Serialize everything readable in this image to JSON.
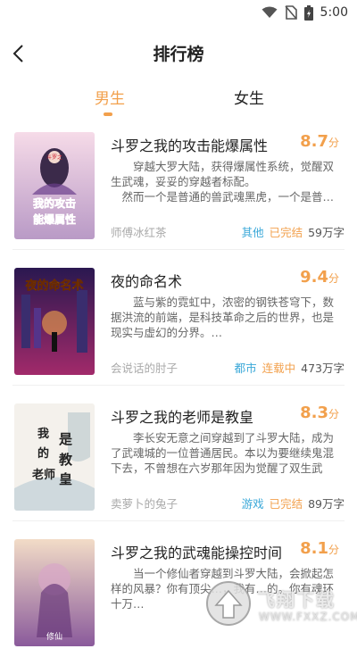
{
  "status_bar": {
    "time": "5:00"
  },
  "header": {
    "title": "排行榜"
  },
  "tabs": [
    {
      "label": "男生",
      "active": true
    },
    {
      "label": "女生",
      "active": false
    }
  ],
  "books": [
    {
      "title": "斗罗之我的攻击能爆属性",
      "score": "8.7",
      "score_unit": "分",
      "desc": "穿越大罗大陆，获得爆属性系统，觉醒双生武魂，妥妥的穿越者标配。\n然而一个是普通的兽武魂黑虎，一个是普…",
      "author": "师傅冰红茶",
      "genre": "其他",
      "status": "已完结",
      "words": "59万字",
      "cover_text": "我的攻击能爆属性",
      "cover_tag": "斗罗之"
    },
    {
      "title": "夜的命名术",
      "score": "9.4",
      "score_unit": "分",
      "desc": "蓝与紫的霓虹中，浓密的钢铁苍穹下，数据洪流的前端，是科技革命之后的世界，也是现实与虚幻的分界。…",
      "author": "会说话的肘子",
      "genre": "都市",
      "status": "连载中",
      "words": "473万字",
      "cover_text": "夜的命名术"
    },
    {
      "title": "斗罗之我的老师是教皇",
      "score": "8.3",
      "score_unit": "分",
      "desc": "李长安无意之间穿越到了斗罗大陆，成为了武魂城的一位普通居民。本以为要继续鬼混下去，不曾想在六岁那年因为觉醒了双生武魂…",
      "author": "卖萝卜的兔子",
      "genre": "游戏",
      "status": "已完结",
      "words": "89万字",
      "cover_text": "我的老师是教皇"
    },
    {
      "title": "斗罗之我的武魂能操控时间",
      "score": "8.1",
      "score_unit": "分",
      "desc": "当一个修仙者穿越到斗罗大陆，会掀起怎样的风暴？你有顶尖…，我有…的。你有魂环十万…",
      "author": "",
      "genre": "",
      "status": "",
      "words": "",
      "cover_text": "修仙"
    }
  ],
  "watermark": {
    "text": "飞翔下载",
    "sub": "WWW.FXXZ.COM"
  }
}
